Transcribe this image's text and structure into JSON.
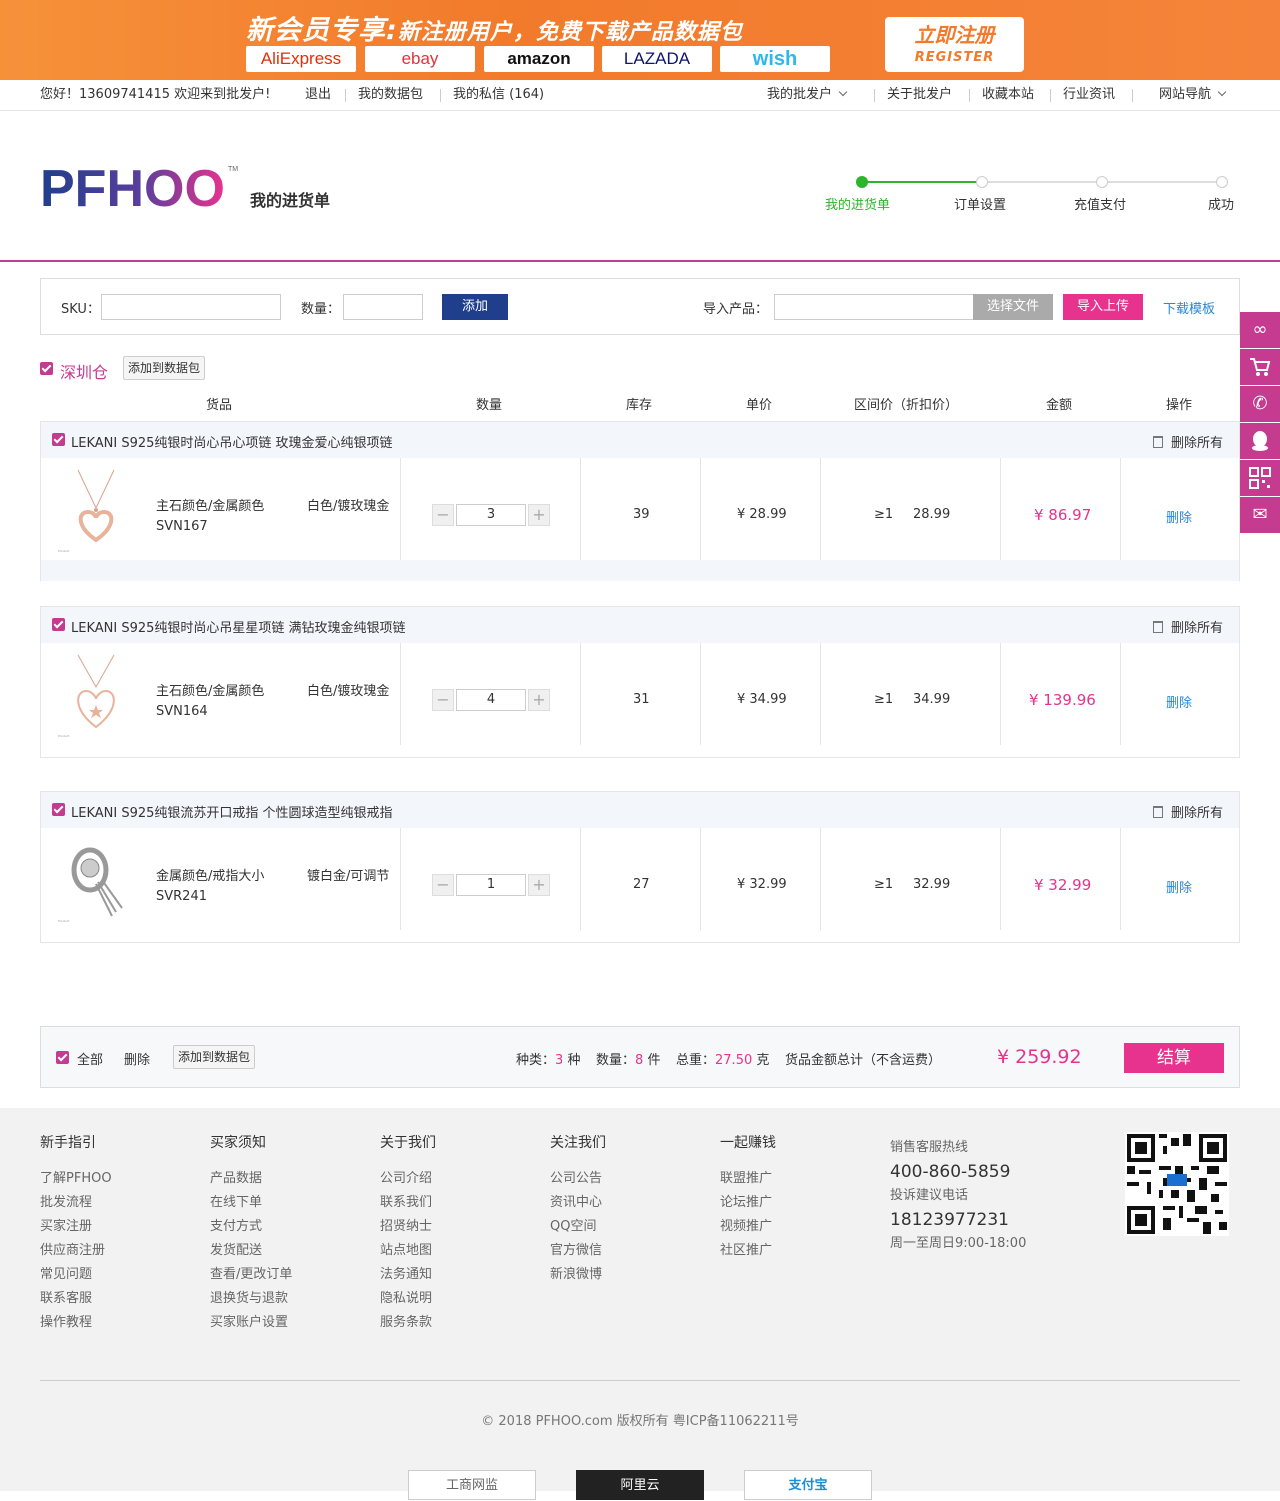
{
  "banner": {
    "title_a": "新会员专享:",
    "title_b": "新注册用户，免费下载产品数据包",
    "marketplaces": [
      "AliExpress",
      "ebay",
      "amazon",
      "LAZADA",
      "wish"
    ],
    "register_cn": "立即注册",
    "register_en": "REGISTER"
  },
  "topbar": {
    "greeting": "您好！13609741415  欢迎来到批发户!",
    "logout": "退出",
    "datapack": "我的数据包",
    "messages": "我的私信 (164)",
    "my": "我的批发户",
    "about": "关于批发户",
    "fav": "收藏本站",
    "news": "行业资讯",
    "nav": "网站导航"
  },
  "header": {
    "logo": "PFHOO",
    "tm": "TM",
    "title": "我的进货单",
    "steps": [
      "我的进货单",
      "订单设置",
      "充值支付",
      "成功"
    ]
  },
  "addbar": {
    "sku_label": "SKU：",
    "qty_label": "数量：",
    "add": "添加",
    "import_label": "导入产品：",
    "choose_file": "选择文件",
    "upload": "导入上传",
    "download": "下载模板"
  },
  "warehouse": {
    "name": "深圳仓",
    "add_pack": "添加到数据包"
  },
  "columns": [
    "货品",
    "数量",
    "库存",
    "单价",
    "区间价（折扣价）",
    "金额",
    "操作"
  ],
  "groups": [
    {
      "title": "LEKANI S925纯银时尚心吊心项链 玫瑰金爱心纯银项链",
      "del_all": "删除所有",
      "attr_name": "主石颜色/金属颜色",
      "attr_value": "白色/镀玫瑰金",
      "sku": "SVN167",
      "qty": "3",
      "stock": "39",
      "price": "¥  28.99",
      "range": "≥1",
      "range_price": "28.99",
      "amount": "¥  86.97",
      "del": "删除"
    },
    {
      "title": "LEKANI S925纯银时尚心吊星星项链 满钻玫瑰金纯银项链",
      "del_all": "删除所有",
      "attr_name": "主石颜色/金属颜色",
      "attr_value": "白色/镀玫瑰金",
      "sku": "SVN164",
      "qty": "4",
      "stock": "31",
      "price": "¥  34.99",
      "range": "≥1",
      "range_price": "34.99",
      "amount": "¥  139.96",
      "del": "删除"
    },
    {
      "title": "LEKANI S925纯银流苏开口戒指 个性圆球造型纯银戒指",
      "del_all": "删除所有",
      "attr_name": "金属颜色/戒指大小",
      "attr_value": "镀白金/可调节",
      "sku": "SVR241",
      "qty": "1",
      "stock": "27",
      "price": "¥  32.99",
      "range": "≥1",
      "range_price": "32.99",
      "amount": "¥  32.99",
      "del": "删除"
    }
  ],
  "summary": {
    "all": "全部",
    "delete": "删除",
    "add_pack": "添加到数据包",
    "kinds_label": "种类：",
    "kinds": "3",
    "kinds_unit": "种",
    "count_label": "数量：",
    "count": "8",
    "count_unit": "件",
    "weight_label": "总重：",
    "weight": "27.50",
    "weight_unit": "克",
    "total_label": "货品金额总计（不含运费）",
    "total": "¥ 259.92",
    "checkout": "结算"
  },
  "footer": {
    "cols": [
      {
        "h": "新手指引",
        "items": [
          "了解PFHOO",
          "批发流程",
          "买家注册",
          "供应商注册",
          "常见问题",
          "联系客服",
          "操作教程"
        ]
      },
      {
        "h": "买家须知",
        "items": [
          "产品数据",
          "在线下单",
          "支付方式",
          "发货配送",
          "查看/更改订单",
          "退换货与退款",
          "买家账户设置"
        ]
      },
      {
        "h": "关于我们",
        "items": [
          "公司介绍",
          "联系我们",
          "招贤纳士",
          "站点地图",
          "法务通知",
          "隐私说明",
          "服务条款"
        ]
      },
      {
        "h": "关注我们",
        "items": [
          "公司公告",
          "资讯中心",
          "QQ空间",
          "官方微信",
          "新浪微博"
        ]
      },
      {
        "h": "一起赚钱",
        "items": [
          "联盟推广",
          "论坛推广",
          "视频推广",
          "社区推广"
        ]
      }
    ],
    "hotline_label": "销售客服热线",
    "hotline": "400-860-5859",
    "complaint_label": "投诉建议电话",
    "complaint": "18123977231",
    "hours": "周一至周日9:00-18:00",
    "copyright": "© 2018 PFHOO.com 版权所有 粤ICP备11062211号",
    "badges": [
      "工商网监",
      "阿里云",
      "支付宝"
    ]
  },
  "colors": {
    "accent": "#c43b8f",
    "pink": "#e7338e",
    "navy": "#1f3f8c",
    "green": "#2bb52b",
    "banner": "#f27a2b"
  }
}
